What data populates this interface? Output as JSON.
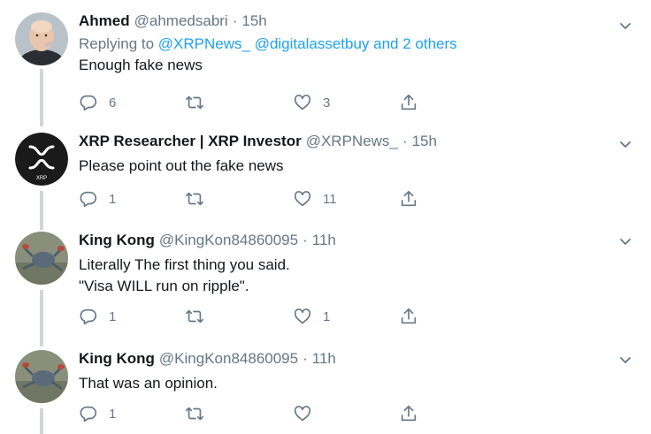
{
  "tweets": [
    {
      "name": "Ahmed",
      "handle": "@ahmedsabri",
      "time": "15h",
      "replying_label": "Replying to",
      "replying_to": "@XRPNews_ @digitalassetbuy and 2 others",
      "text": "Enough fake news",
      "avatar": "bald-man-avatar",
      "reply_count": "6",
      "retweet_count": "",
      "like_count": "3"
    },
    {
      "name": "XRP Researcher | XRP Investor",
      "handle": "@XRPNews_",
      "time": "15h",
      "text": "Please point out the fake news",
      "avatar": "xrp-logo-avatar",
      "avatar_label": "XRP",
      "reply_count": "1",
      "retweet_count": "",
      "like_count": "11"
    },
    {
      "name": "King Kong",
      "handle": "@KingKon84860095",
      "time": "11h",
      "text": "Literally The first thing you said.\n\"Visa WILL run on ripple\".",
      "avatar": "crab-avatar",
      "reply_count": "1",
      "retweet_count": "",
      "like_count": "1"
    },
    {
      "name": "King Kong",
      "handle": "@KingKon84860095",
      "time": "11h",
      "text": "That was an opinion.",
      "avatar": "crab-avatar",
      "reply_count": "1",
      "retweet_count": "",
      "like_count": ""
    }
  ],
  "separator": "·",
  "colors": {
    "link": "#1da1f2",
    "muted": "#657786",
    "text": "#14171a",
    "thread_line": "#ccd6dd"
  },
  "icons": {
    "reply": "reply-icon",
    "retweet": "retweet-icon",
    "like": "heart-icon",
    "share": "share-icon",
    "more": "chevron-down-icon"
  }
}
